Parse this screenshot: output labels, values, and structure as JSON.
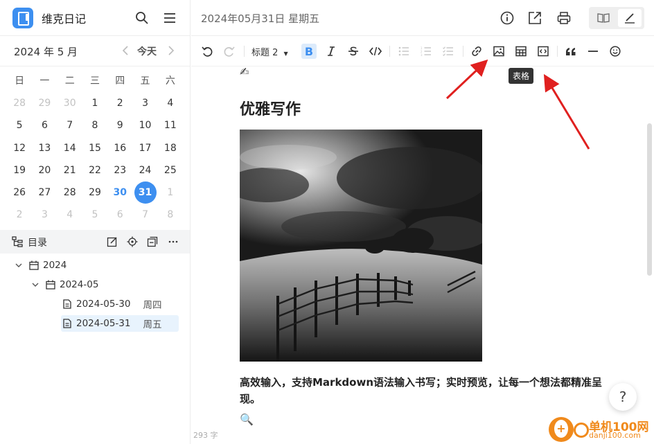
{
  "app": {
    "name": "维克日记"
  },
  "calendar": {
    "month_label": "2024 年 5 月",
    "today_label": "今天",
    "weekdays": [
      "日",
      "一",
      "二",
      "三",
      "四",
      "五",
      "六"
    ],
    "weeks": [
      [
        "28",
        "29",
        "30",
        "1",
        "2",
        "3",
        "4"
      ],
      [
        "5",
        "6",
        "7",
        "8",
        "9",
        "10",
        "11"
      ],
      [
        "12",
        "13",
        "14",
        "15",
        "16",
        "17",
        "18"
      ],
      [
        "19",
        "20",
        "21",
        "22",
        "23",
        "24",
        "25"
      ],
      [
        "26",
        "27",
        "28",
        "29",
        "30",
        "31",
        "1"
      ],
      [
        "2",
        "3",
        "4",
        "5",
        "6",
        "7",
        "8"
      ]
    ]
  },
  "toc": {
    "title": "目录",
    "tree": {
      "year": "2024",
      "month": "2024-05",
      "entries": [
        {
          "date": "2024-05-30",
          "weekday": "周四"
        },
        {
          "date": "2024-05-31",
          "weekday": "周五"
        }
      ]
    }
  },
  "header": {
    "date_title": "2024年05月31日 星期五"
  },
  "toolbar": {
    "heading_label": "标题 2",
    "bold_label": "B",
    "tooltip": "表格"
  },
  "document": {
    "emoji_top": "✍",
    "heading": "优雅写作",
    "paragraph": "高效输入，支持Markdown语法输入书写；实时预览，让每一个想法都精准呈现。",
    "emoji_bottom": "🔍",
    "word_count": "293 字"
  },
  "help": {
    "label": "?"
  },
  "watermark": {
    "name": "单机100网",
    "url": "danji100.com"
  },
  "colors": {
    "accent": "#3d8ff0",
    "arrow": "#e0201f",
    "watermark": "#f08a1c"
  }
}
